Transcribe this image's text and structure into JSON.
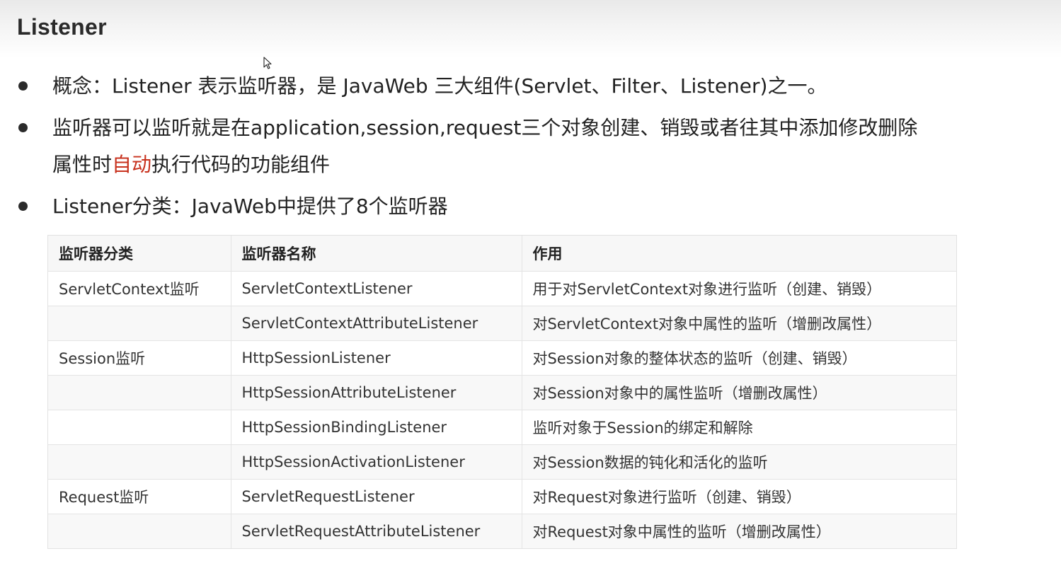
{
  "header": {
    "title": "Listener"
  },
  "bullets": [
    {
      "text": "概念：Listener 表示监听器，是 JavaWeb 三大组件(Servlet、Filter、Listener)之一。"
    },
    {
      "line1": "监听器可以监听就是在application,session,request三个对象创建、销毁或者往其中添加修改删除",
      "line2_before": "属性时",
      "line2_highlight": "自动",
      "line2_after": "执行代码的功能组件",
      "highlight_color": "#c8321e"
    },
    {
      "text": "Listener分类：JavaWeb中提供了8个监听器"
    }
  ],
  "table": {
    "headers": [
      "监听器分类",
      "监听器名称",
      "作用"
    ],
    "rows": [
      [
        "ServletContext监听",
        "ServletContextListener",
        "用于对ServletContext对象进行监听（创建、销毁）"
      ],
      [
        "",
        "ServletContextAttributeListener",
        "对ServletContext对象中属性的监听（增删改属性）"
      ],
      [
        "Session监听",
        "HttpSessionListener",
        "对Session对象的整体状态的监听（创建、销毁）"
      ],
      [
        "",
        "HttpSessionAttributeListener",
        "对Session对象中的属性监听（增删改属性）"
      ],
      [
        "",
        "HttpSessionBindingListener",
        "监听对象于Session的绑定和解除"
      ],
      [
        "",
        "HttpSessionActivationListener",
        "对Session数据的钝化和活化的监听"
      ],
      [
        "Request监听",
        "ServletRequestListener",
        "对Request对象进行监听（创建、销毁）"
      ],
      [
        "",
        "ServletRequestAttributeListener",
        "对Request对象中属性的监听（增删改属性）"
      ]
    ]
  }
}
